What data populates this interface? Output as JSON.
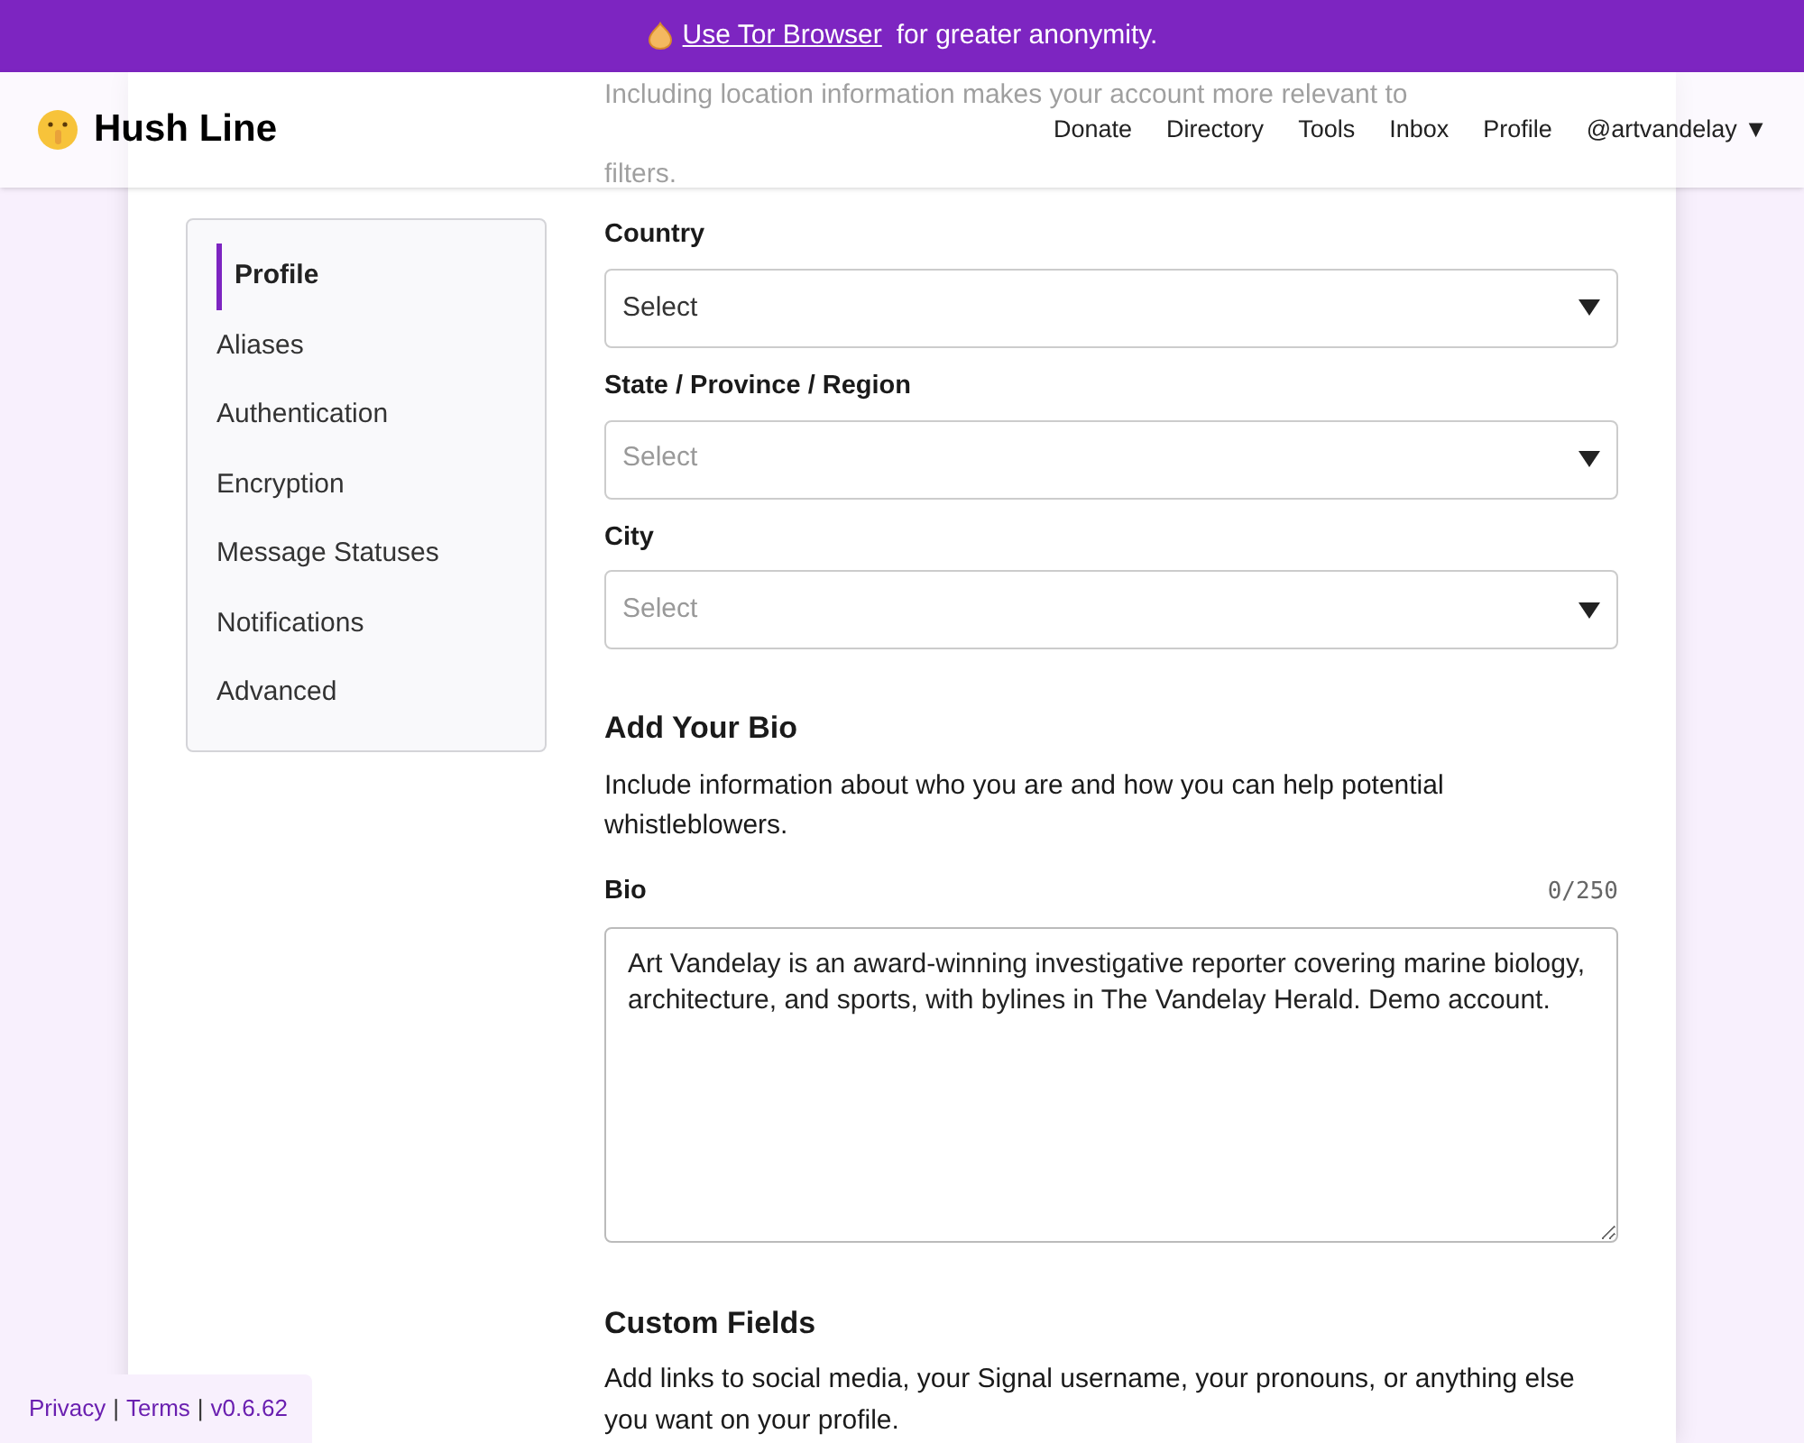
{
  "banner": {
    "text": "for greater anonymity.",
    "link": "Use Tor Browser"
  },
  "header": {
    "logo": "Hush Line",
    "nav": [
      "Donate",
      "Directory",
      "Tools",
      "Inbox",
      "Profile"
    ],
    "user_menu": "@artvandelay ▼"
  },
  "intro_partial": [
    "Including location information makes your account more relevant to",
    "filters."
  ],
  "sidebar": {
    "items": [
      {
        "label": "Profile",
        "selected": true
      },
      {
        "label": "Aliases",
        "selected": false
      },
      {
        "label": "Authentication",
        "selected": false
      },
      {
        "label": "Encryption",
        "selected": false
      },
      {
        "label": "Message Statuses",
        "selected": false
      },
      {
        "label": "Notifications",
        "selected": false
      },
      {
        "label": "Advanced",
        "selected": false
      }
    ]
  },
  "location_fields": [
    {
      "label": "Country",
      "value": "Select",
      "disabled": false
    },
    {
      "label": "State / Province / Region",
      "value": "Select",
      "disabled": true
    },
    {
      "label": "City",
      "value": "Select",
      "disabled": true
    }
  ],
  "bio_section": {
    "title": "Add Your Bio",
    "description": "Include information about who you are and how you can help potential whistleblowers.",
    "label": "Bio",
    "counter": "0/250",
    "value": "Art Vandelay is an award-winning investigative reporter covering marine biology, architecture, and sports, with bylines in The Vandelay Herald. Demo account."
  },
  "custom_fields": {
    "title": "Custom Fields",
    "description": "Add links to social media, your Signal username, your pronouns, or anything else you want on your profile."
  },
  "footer": {
    "links": [
      "Privacy",
      "Terms",
      "v0.6.62"
    ],
    "separators": [
      "|",
      "|"
    ]
  }
}
